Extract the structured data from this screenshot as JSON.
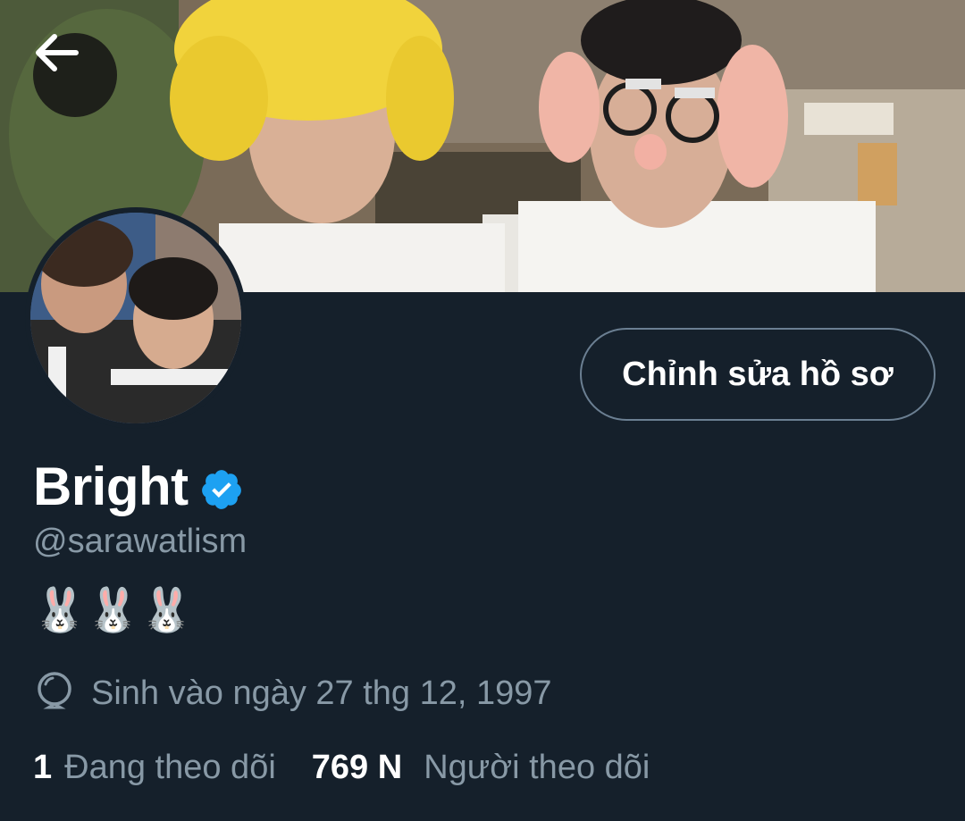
{
  "header": {
    "back_icon": "arrow-left-icon",
    "banner_image": "two people in costume wigs and glasses"
  },
  "profile": {
    "avatar_image": "two young men embracing",
    "edit_button_label": "Chỉnh sửa hồ sơ",
    "display_name": "Bright",
    "verified_icon": "verified-badge-icon",
    "handle": "@sarawatlism",
    "bio": "🐰🐰🐰",
    "birth_icon": "balloon-icon",
    "birth_text": "Sinh vào ngày 27 thg 12, 1997"
  },
  "stats": {
    "following_count": "1",
    "following_label": "Đang theo dõi",
    "followers_count": "769 N",
    "followers_label": "Người theo dõi"
  },
  "colors": {
    "background": "#15202b",
    "muted_text": "#8899a6",
    "verified": "#1da1f2",
    "button_border": "#6b7f92"
  }
}
